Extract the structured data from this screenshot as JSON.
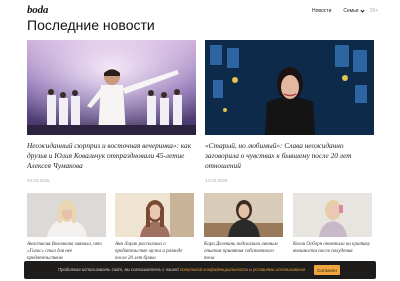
{
  "header": {
    "logo": "boda",
    "nav": [
      "Новости",
      "Семья"
    ],
    "lang": "18+"
  },
  "section": {
    "title": "Последние новости"
  },
  "featured": [
    {
      "title": "Неожиданный сюрприз и восточная вечеринка»: как друзья и Юлия Ковальчук отпраздновали 45-летие Алексея Чумакова",
      "date": "04.03.2026"
    },
    {
      "title": "«Старый, но любимый»: Слава неожиданно заговорила о чувствах к бывшему после 20 лет отношений",
      "date": "14.03.2026"
    }
  ],
  "cards": [
    {
      "title": "Анастасия Волочкова заявила, что «Голос» стал для нее предательством"
    },
    {
      "title": "Аня Лорак рассказала о предательстве мужа и разводе после 20 лет брака"
    },
    {
      "title": "Кара Делевинь подсказала личным опытом принятия собственного тела"
    },
    {
      "title": "Келли Осборн ответила на критику внешности после похудения"
    }
  ],
  "cookie": {
    "text_before": "Продолжая использовать сайт, вы соглашаетесь с нашей",
    "link1": "политикой конфиденциальности",
    "text_mid": "и",
    "link2": "условиями использования",
    "button": "Согласен"
  }
}
